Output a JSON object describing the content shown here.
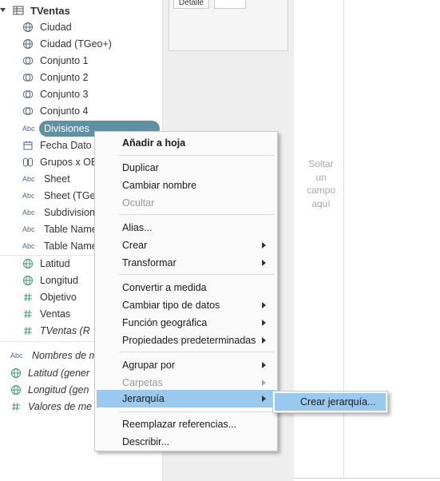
{
  "data_pane": {
    "datasource": "TVentas",
    "dimensions": [
      {
        "icon": "globe-icon",
        "label": "Ciudad"
      },
      {
        "icon": "globe-icon",
        "label": "Ciudad (TGeo+)"
      },
      {
        "icon": "set-icon",
        "label": "Conjunto 1"
      },
      {
        "icon": "set-icon",
        "label": "Conjunto 2"
      },
      {
        "icon": "set-icon",
        "label": "Conjunto 3"
      },
      {
        "icon": "set-icon",
        "label": "Conjunto 4"
      },
      {
        "icon": "abc-icon",
        "label": "Divisiones",
        "selected": true
      },
      {
        "icon": "calendar-icon",
        "label": "Fecha Dato"
      },
      {
        "icon": "paperclip-icon",
        "label": "Grupos x OB"
      },
      {
        "icon": "abc-icon",
        "label": "Sheet"
      },
      {
        "icon": "abc-icon",
        "label": "Sheet (TGeo"
      },
      {
        "icon": "abc-icon",
        "label": "Subdivision"
      },
      {
        "icon": "abc-icon",
        "label": "Table Name"
      },
      {
        "icon": "abc-icon",
        "label": "Table Name"
      }
    ],
    "measures": [
      {
        "icon": "globe-icon",
        "label": "Latitud"
      },
      {
        "icon": "globe-icon",
        "label": "Longitud"
      },
      {
        "icon": "hash-icon",
        "label": "Objetivo"
      },
      {
        "icon": "hash-icon",
        "label": "Ventas"
      },
      {
        "icon": "hash-icon",
        "label": "TVentas (R"
      }
    ],
    "generated": [
      {
        "icon": "abc-icon",
        "label": "Nombres de m"
      },
      {
        "icon": "globe-icon",
        "label": "Latitud (gener"
      },
      {
        "icon": "globe-icon",
        "label": "Longitud (gen"
      },
      {
        "icon": "hash-icon",
        "label": "Valores de me"
      }
    ],
    "abc_text": "Abc"
  },
  "marks": {
    "detail_label": "Detalle"
  },
  "view": {
    "drop_text": [
      "Soltar",
      "un",
      "campo",
      "aquí"
    ]
  },
  "context_menu": {
    "items": [
      {
        "label": "Añadir a hoja",
        "bold": true
      },
      {
        "label": "Duplicar"
      },
      {
        "label": "Cambiar nombre"
      },
      {
        "label": "Ocultar",
        "disabled": true
      },
      {
        "label": "Alias..."
      },
      {
        "label": "Crear",
        "submenu": true
      },
      {
        "label": "Transformar",
        "submenu": true
      },
      {
        "label": "Convertir a medida"
      },
      {
        "label": "Cambiar tipo de datos",
        "submenu": true
      },
      {
        "label": "Función geográfica",
        "submenu": true
      },
      {
        "label": "Propiedades predeterminadas",
        "submenu": true
      },
      {
        "label": "Agrupar por",
        "submenu": true
      },
      {
        "label": "Carpetas",
        "submenu": true,
        "disabled": true
      },
      {
        "label": "Jerarquía",
        "submenu": true,
        "highlighted": true
      },
      {
        "label": "Reemplazar referencias..."
      },
      {
        "label": "Describir..."
      }
    ]
  },
  "submenu": {
    "item": "Crear jerarquía..."
  },
  "colors": {
    "selection_pill": "#5d91a5",
    "menu_highlight": "#99c9ef",
    "icon_green": "#3f9b6d",
    "icon_blue": "#4d6a83"
  }
}
